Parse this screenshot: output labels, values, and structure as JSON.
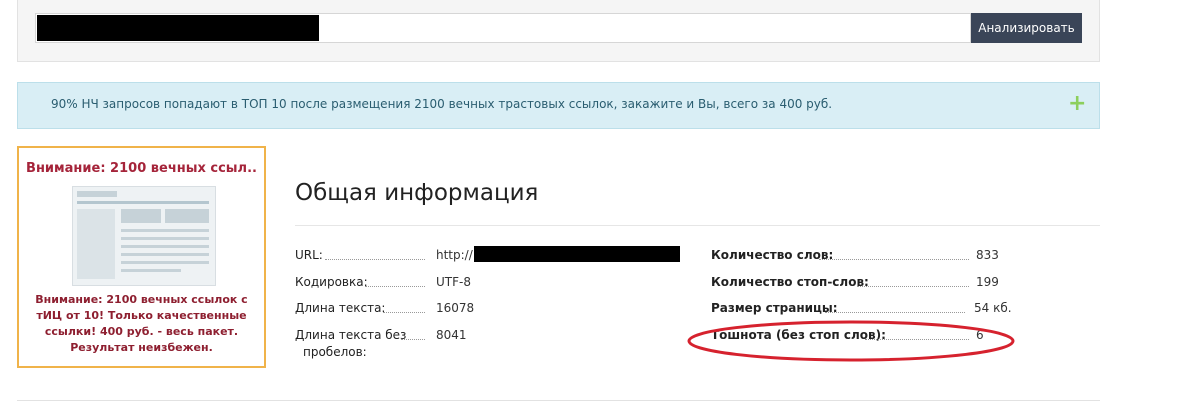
{
  "search": {
    "analyze_label": "Анализировать"
  },
  "promo": {
    "text": "90% НЧ запросов попадают в ТОП 10 после размещения 2100 вечных трастовых ссылок, закажите и Вы, всего за 400 руб.",
    "expand_symbol": "+"
  },
  "ad": {
    "title": "Внимание: 2100 вечных ссыл..",
    "body": "Внимание: 2100 вечных ссылок с тИЦ от 10! Только качественные ссылки! 400 руб. - весь пакет. Результат неизбежен."
  },
  "info": {
    "title": "Общая информация",
    "left": [
      {
        "label": "URL:",
        "value": "http://"
      },
      {
        "label": "Кодировка:",
        "value": "UTF-8"
      },
      {
        "label": "Длина текста:",
        "value": "16078"
      },
      {
        "label_line1": "Длина текста без",
        "label_line2": "пробелов:",
        "value": "8041"
      }
    ],
    "right": [
      {
        "label": "Количество слов:",
        "value": "833"
      },
      {
        "label": "Количество стоп-слов:",
        "value": "199"
      },
      {
        "label": "Размер страницы:",
        "value": "54 кб."
      },
      {
        "label": "Тошнота (без стоп слов):",
        "value": "6"
      }
    ]
  },
  "colors": {
    "accent_button": "#3a4558",
    "banner_bg": "#d9eef5",
    "ad_border": "#f0b34a",
    "ad_text": "#a5243a",
    "highlight": "#d6222e"
  }
}
